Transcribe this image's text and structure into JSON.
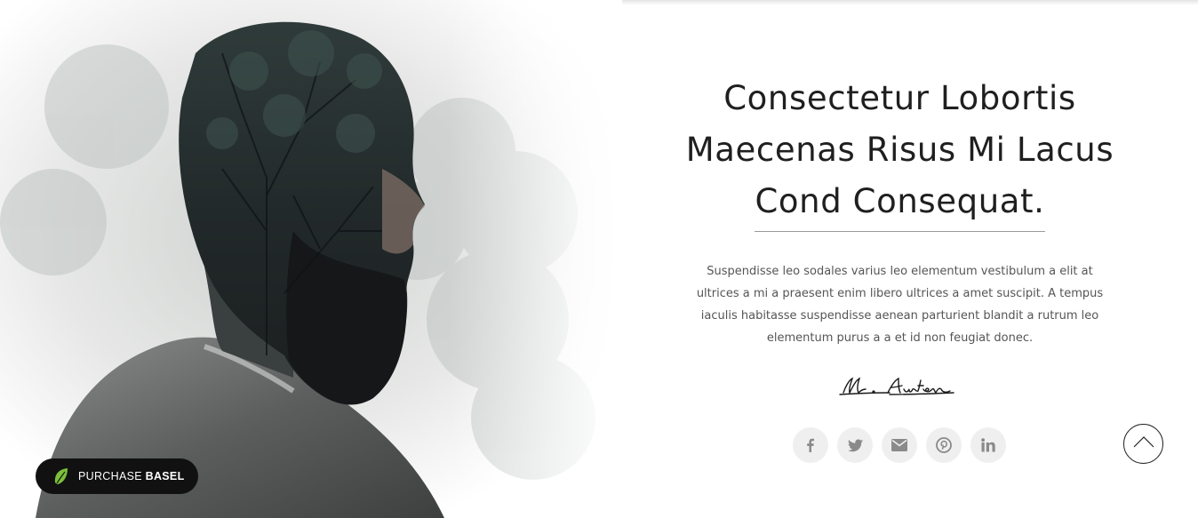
{
  "hero": {
    "title_lines": [
      "Consectetur Lobortis",
      "Maecenas Risus Mi Lacus",
      "Cond Consequat."
    ],
    "description": "Suspendisse leo sodales varius leo elementum vestibulum a elit at ultrices a mi a praesent enim libero ultrices a amet suscipit. A tempus iaculis habitasse suspendisse aenean parturient blandit a rutrum leo elementum purus a a et id non feugiat donec.",
    "signature": "M. Austen"
  },
  "social": [
    {
      "name": "facebook-icon",
      "label": "f"
    },
    {
      "name": "twitter-icon"
    },
    {
      "name": "email-icon"
    },
    {
      "name": "pinterest-icon"
    },
    {
      "name": "linkedin-icon",
      "label": "in"
    }
  ],
  "purchase": {
    "prefix": "PURCHASE",
    "brand": "BASEL"
  },
  "colors": {
    "text": "#1f1f1f",
    "body_text": "#555555",
    "social_bg": "#efefef",
    "social_icon": "#8a8a8a",
    "badge_bg": "#111111",
    "leaf": "#7cbf3b"
  }
}
